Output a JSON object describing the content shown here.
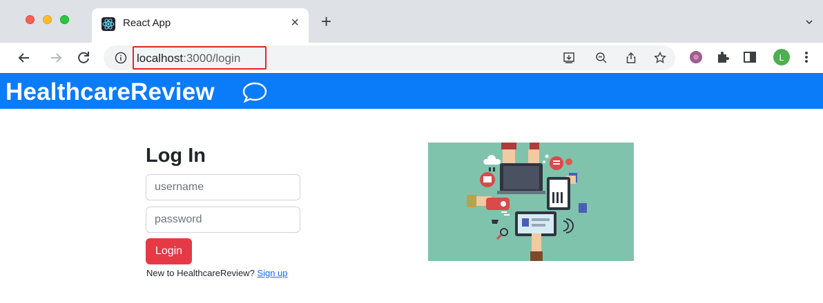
{
  "browser": {
    "tab": {
      "title": "React App",
      "close": "×"
    },
    "new_tab": "+",
    "url": {
      "host": "localhost",
      "path": ":3000/login"
    },
    "profile_initial": "L"
  },
  "navbar": {
    "brand": "HealthcareReview",
    "icon": "speech-bubble-icon",
    "color": "#0b7cf9"
  },
  "login": {
    "title": "Log In",
    "username_placeholder": "username",
    "password_placeholder": "password",
    "button_label": "Login",
    "button_color": "#e63946",
    "signup_prompt": "New to HealthcareReview?",
    "signup_link": "Sign up"
  },
  "illustration": {
    "icon": "connected-devices-illustration",
    "background": "#80c3ac"
  }
}
